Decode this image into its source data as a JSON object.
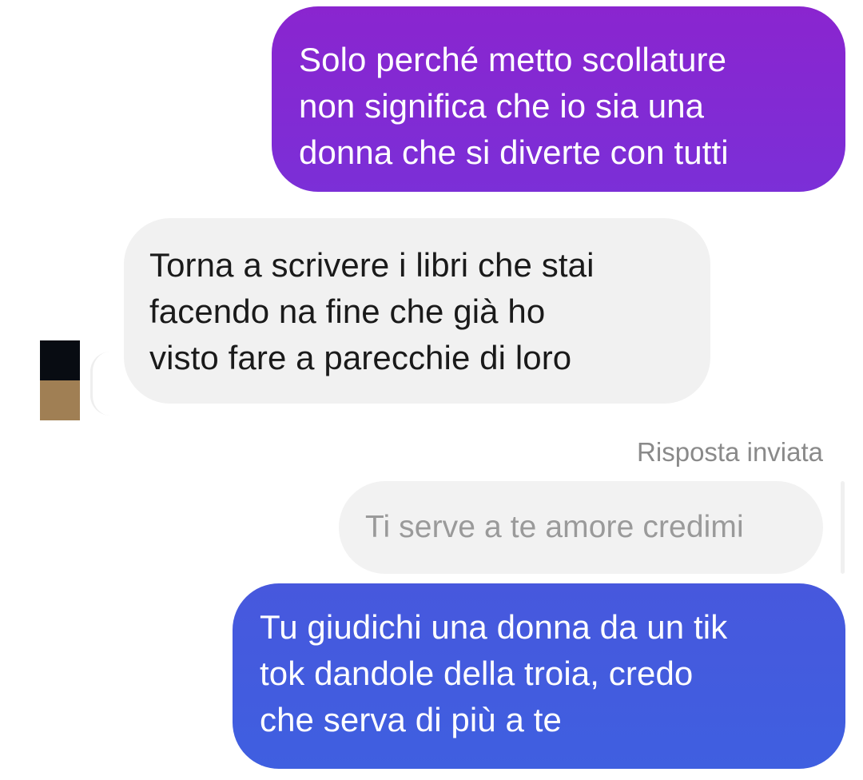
{
  "conversation": {
    "messages": [
      {
        "direction": "sent",
        "color": "#8a25cf",
        "lines": [
          "Solo perché metto scollature",
          "non significa che io sia una",
          "donna che si diverte con tutti"
        ]
      },
      {
        "direction": "received",
        "color": "#f1f1f1",
        "lines": [
          "Torna a scrivere i libri che stai",
          "facendo na fine che già ho",
          "visto fare a parecchie di loro"
        ]
      },
      {
        "direction": "sent",
        "color": "#4758dd",
        "reply_label": "Risposta inviata",
        "quoted_text": "Ti serve a te amore credimi",
        "lines": [
          "Tu giudichi una donna da un tik",
          "tok dandole della troia, credo",
          "che serva di più a te"
        ]
      }
    ],
    "colors": {
      "sent_purple": "#8a25cf",
      "sent_blue": "#4758dd",
      "received_bg": "#f1f1f1",
      "quote_bg": "#f2f2f2",
      "label_gray": "#8a8a8a"
    }
  }
}
